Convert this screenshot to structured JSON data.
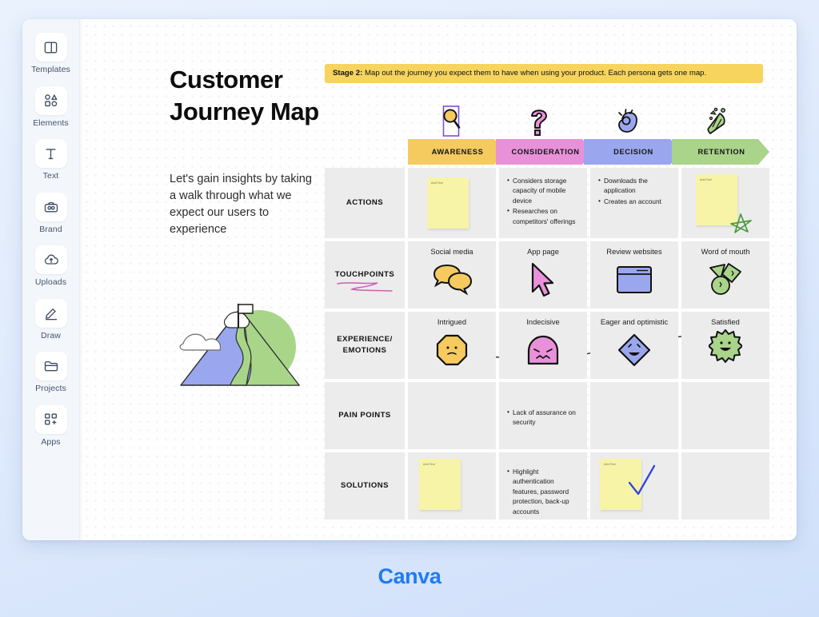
{
  "app": {
    "name": "Canva",
    "logo_text": "Canva",
    "accent_color": "#1f7bf4"
  },
  "sidebar": {
    "items": [
      {
        "id": "templates",
        "label": "Templates",
        "icon": "templates-icon"
      },
      {
        "id": "elements",
        "label": "Elements",
        "icon": "elements-icon"
      },
      {
        "id": "text",
        "label": "Text",
        "icon": "text-icon"
      },
      {
        "id": "brand",
        "label": "Brand",
        "icon": "brand-icon"
      },
      {
        "id": "uploads",
        "label": "Uploads",
        "icon": "uploads-icon"
      },
      {
        "id": "draw",
        "label": "Draw",
        "icon": "draw-icon"
      },
      {
        "id": "projects",
        "label": "Projects",
        "icon": "projects-icon"
      },
      {
        "id": "apps",
        "label": "Apps",
        "icon": "apps-icon"
      }
    ]
  },
  "design": {
    "title": "Customer Journey Map",
    "subtitle": "Let's gain insights by taking a walk through what we expect our users to experience",
    "illustration": "mountain-with-flag-illustration",
    "banner": {
      "prefix": "Stage 2:",
      "text": " Map out the journey you expect them to have when using your product. Each persona gets one map.",
      "color": "#f7d45e"
    }
  },
  "chart_data": {
    "type": "table",
    "title": "Customer Journey Map",
    "stages": [
      {
        "label": "AWARENESS",
        "color": "#f5ca5e",
        "icon": "magnifying-glass-icon"
      },
      {
        "label": "CONSIDERATION",
        "color": "#e891d9",
        "icon": "question-mark-icon"
      },
      {
        "label": "DECISION",
        "color": "#9aa7ef",
        "icon": "ok-hand-icon"
      },
      {
        "label": "RETENTION",
        "color": "#a9d48a",
        "icon": "party-popper-icon"
      }
    ],
    "rows": [
      {
        "label": "ACTIONS",
        "cells": [
          {
            "type": "sticky",
            "sticky_text": "Add Text"
          },
          {
            "type": "bullets",
            "bullets": [
              "Considers storage capacity of mobile device",
              "Researches on competitors' offerings"
            ]
          },
          {
            "type": "bullets",
            "bullets": [
              "Downloads the application",
              "Creates an account"
            ]
          },
          {
            "type": "sticky",
            "sticky_text": "Add Text",
            "doodle": "green-star-doodle"
          }
        ]
      },
      {
        "label": "TOUCHPOINTS",
        "label_doodle": "pink-squiggle-doodle",
        "cells": [
          {
            "type": "art",
            "caption": "Social media",
            "art": "speech-bubbles-icon"
          },
          {
            "type": "art",
            "caption": "App page",
            "art": "cursor-arrow-icon"
          },
          {
            "type": "art",
            "caption": "Review websites",
            "art": "browser-window-icon"
          },
          {
            "type": "art",
            "caption": "Word of mouth",
            "art": "shapes-cluster-icon"
          }
        ]
      },
      {
        "label": "EXPERIENCE/ EMOTIONS",
        "cells": [
          {
            "type": "emotion",
            "caption": "Intrigued",
            "art": "octagon-smiley-icon",
            "color": "#f5ca5e"
          },
          {
            "type": "emotion",
            "caption": "Indecisive",
            "art": "dome-confused-icon",
            "color": "#e891d9"
          },
          {
            "type": "emotion",
            "caption": "Eager and optimistic",
            "art": "diamond-happy-icon",
            "color": "#9aa7ef"
          },
          {
            "type": "emotion",
            "caption": "Satisfied",
            "art": "starburst-grin-icon",
            "color": "#a9d48a"
          }
        ]
      },
      {
        "label": "PAIN POINTS",
        "cells": [
          {
            "type": "empty"
          },
          {
            "type": "bullets",
            "bullets": [
              "Lack of assurance on security"
            ]
          },
          {
            "type": "empty"
          },
          {
            "type": "empty"
          }
        ]
      },
      {
        "label": "SOLUTIONS",
        "cells": [
          {
            "type": "sticky",
            "sticky_text": "Add Text"
          },
          {
            "type": "bullets",
            "bullets": [
              "Highlight authentication features, password protection, back-up accounts"
            ]
          },
          {
            "type": "sticky",
            "sticky_text": "Add Text",
            "doodle": "blue-checkmark-doodle"
          },
          {
            "type": "empty"
          }
        ]
      }
    ]
  }
}
